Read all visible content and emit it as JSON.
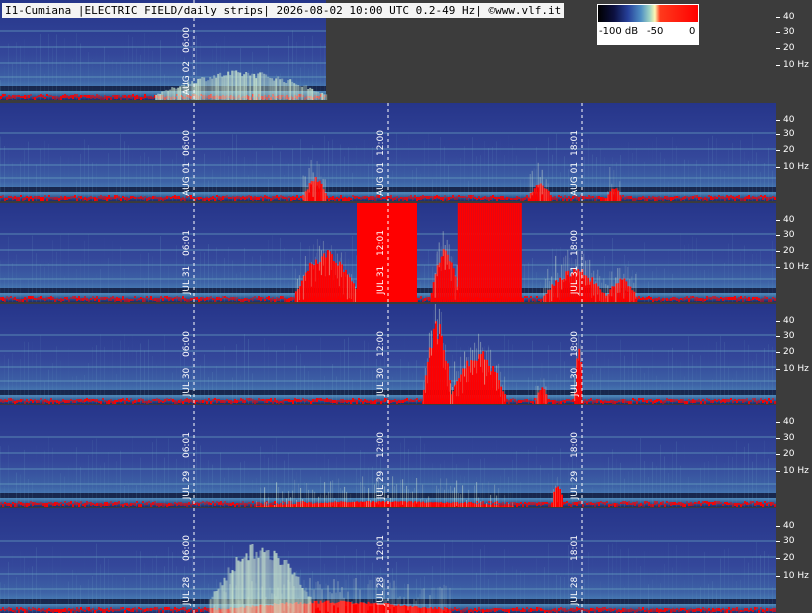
{
  "header": {
    "title": "I1-Cumiana |ELECTRIC FIELD/daily strips| 2026-08-02 10:00 UTC 0.2-49 Hz| ©www.vlf.it"
  },
  "colorbar": {
    "labels": [
      "-100 dB",
      "-50",
      "0"
    ],
    "colors": [
      "#000000",
      "#0c1040",
      "#26409a",
      "#4f8fc4",
      "#a3d7c4",
      "#fff6b5",
      "#ff3a1c",
      "#ff0000"
    ]
  },
  "axis": {
    "ticks": [
      "40",
      "30",
      "20",
      "10 Hz"
    ]
  },
  "colors": {
    "background": "#3c3c3c",
    "spectrogram_base": "#2f3f92",
    "noise_band": "#6aa6c4",
    "signal": "#ff0000"
  },
  "strips": [
    {
      "id": "aug-02",
      "coverage_fraction": 0.42,
      "markers": [
        {
          "date": "AUG 02",
          "time": "06:00",
          "hour_fraction": 0.25
        }
      ],
      "activity": [
        {
          "start": 0.2,
          "end": 0.42,
          "level": 0.3,
          "color": "green"
        }
      ]
    },
    {
      "id": "aug-01",
      "coverage_fraction": 1,
      "markers": [
        {
          "date": "AUG 01",
          "time": "06:00",
          "hour_fraction": 0.25
        },
        {
          "date": "AUG 01",
          "time": "12:00",
          "hour_fraction": 0.5
        },
        {
          "date": "AUG 01",
          "time": "18:01",
          "hour_fraction": 0.75
        }
      ],
      "activity": [
        {
          "start": 0.39,
          "end": 0.42,
          "level": 0.25,
          "color": "red"
        },
        {
          "start": 0.68,
          "end": 0.71,
          "level": 0.2,
          "color": "red"
        },
        {
          "start": 0.78,
          "end": 0.8,
          "level": 0.15,
          "color": "red"
        }
      ]
    },
    {
      "id": "jul-31",
      "coverage_fraction": 1,
      "markers": [
        {
          "date": "JUL 31",
          "time": "06:01",
          "hour_fraction": 0.25
        },
        {
          "date": "JUL 31",
          "time": "12:01",
          "hour_fraction": 0.5
        },
        {
          "date": "JUL 31",
          "time": "18:00",
          "hour_fraction": 0.75
        }
      ],
      "activity": [
        {
          "start": 0.38,
          "end": 0.46,
          "level": 0.55,
          "color": "red"
        },
        {
          "start": 0.46,
          "end": 0.535,
          "level": 1.0,
          "color": "red"
        },
        {
          "start": 0.555,
          "end": 0.59,
          "level": 0.55,
          "color": "red"
        },
        {
          "start": 0.59,
          "end": 0.67,
          "level": 1.0,
          "color": "red"
        },
        {
          "start": 0.7,
          "end": 0.78,
          "level": 0.35,
          "color": "red"
        },
        {
          "start": 0.78,
          "end": 0.82,
          "level": 0.25,
          "color": "red"
        }
      ]
    },
    {
      "id": "jul-30",
      "coverage_fraction": 1,
      "markers": [
        {
          "date": "JUL 30",
          "time": "06:00",
          "hour_fraction": 0.25
        },
        {
          "date": "JUL 30",
          "time": "12:00",
          "hour_fraction": 0.5
        },
        {
          "date": "JUL 30",
          "time": "18:00",
          "hour_fraction": 0.75
        }
      ],
      "activity": [
        {
          "start": 0.545,
          "end": 0.58,
          "level": 0.85,
          "color": "red"
        },
        {
          "start": 0.58,
          "end": 0.65,
          "level": 0.55,
          "color": "red"
        },
        {
          "start": 0.69,
          "end": 0.705,
          "level": 0.2,
          "color": "red"
        },
        {
          "start": 0.74,
          "end": 0.75,
          "level": 0.7,
          "color": "red"
        }
      ]
    },
    {
      "id": "jul-29",
      "coverage_fraction": 1,
      "markers": [
        {
          "date": "JUL 29",
          "time": "06:01",
          "hour_fraction": 0.25
        },
        {
          "date": "JUL 29",
          "time": "12:00",
          "hour_fraction": 0.5
        },
        {
          "date": "JUL 29",
          "time": "18:00",
          "hour_fraction": 0.75
        }
      ],
      "activity": [
        {
          "start": 0.33,
          "end": 0.66,
          "level": 0.06,
          "color": "red"
        },
        {
          "start": 0.71,
          "end": 0.725,
          "level": 0.25,
          "color": "red"
        }
      ]
    },
    {
      "id": "jul-28",
      "coverage_fraction": 1,
      "markers": [
        {
          "date": "JUL 28",
          "time": "06:00",
          "hour_fraction": 0.25
        },
        {
          "date": "JUL 28",
          "time": "12:01",
          "hour_fraction": 0.5
        },
        {
          "date": "JUL 28",
          "time": "18:01",
          "hour_fraction": 0.75
        }
      ],
      "activity": [
        {
          "start": 0.27,
          "end": 0.58,
          "level": 0.12,
          "color": "red"
        },
        {
          "start": 0.27,
          "end": 0.4,
          "level": 0.7,
          "color": "green"
        }
      ]
    }
  ]
}
